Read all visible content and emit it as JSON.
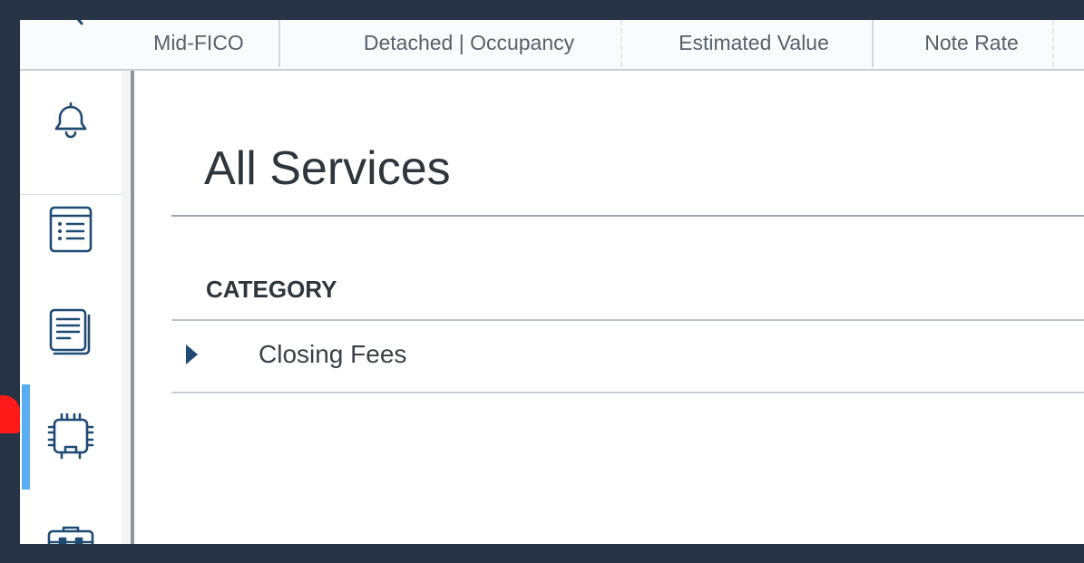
{
  "header": {
    "columns": [
      {
        "label": "Mid-FICO"
      },
      {
        "label": "Detached | Occupancy"
      },
      {
        "label": "Estimated Value"
      },
      {
        "label": "Note Rate"
      }
    ]
  },
  "sidebar": {
    "items": [
      {
        "icon": "bell-icon"
      },
      {
        "icon": "list-icon"
      },
      {
        "icon": "documents-icon"
      },
      {
        "icon": "chip-icon",
        "active": true
      },
      {
        "icon": "briefcase-icon"
      }
    ],
    "active_color": "#5aaef0"
  },
  "main": {
    "title": "All Services",
    "table": {
      "header": "CATEGORY",
      "rows": [
        {
          "label": "Closing Fees"
        }
      ]
    }
  },
  "colors": {
    "frame": "#263445",
    "icon": "#1e4a73",
    "text": "#2f353c"
  }
}
